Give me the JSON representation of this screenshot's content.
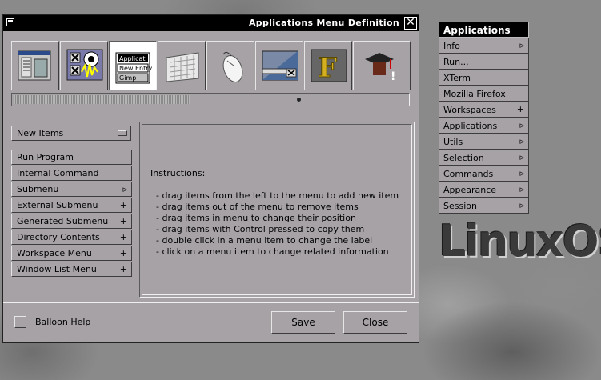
{
  "window": {
    "title": "Applications Menu Definition",
    "close_glyph": "✕"
  },
  "toolbar": {
    "icons": [
      "window-menu-icon",
      "audio-icon",
      "app-entries-icon",
      "keyboard-icon",
      "mouse-icon",
      "window-icon",
      "font-icon",
      "graduation-cap-icon"
    ],
    "active_index": 2,
    "active_texts": [
      "Applicati",
      "New Entry",
      "Gimp"
    ]
  },
  "new_items": {
    "label": "New Items"
  },
  "item_types": [
    {
      "label": "Run Program",
      "marker": ""
    },
    {
      "label": "Internal Command",
      "marker": ""
    },
    {
      "label": "Submenu",
      "marker": "▹"
    },
    {
      "label": "External Submenu",
      "marker": "+"
    },
    {
      "label": "Generated Submenu",
      "marker": "+"
    },
    {
      "label": "Directory Contents",
      "marker": "+"
    },
    {
      "label": "Workspace Menu",
      "marker": "+"
    },
    {
      "label": "Window List Menu",
      "marker": "+"
    }
  ],
  "instructions": {
    "heading": "Instructions:",
    "lines": [
      "- drag items from the left to the menu to add new item",
      "- drag items out of the menu to remove items",
      "- drag items in menu to change their position",
      "- drag items with Control pressed to copy them",
      "- double click in a menu item to change the label",
      "- click on a menu item to change related information"
    ]
  },
  "balloon_help": {
    "label": "Balloon Help",
    "checked": false
  },
  "buttons": {
    "save": "Save",
    "close": "Close"
  },
  "app_menu": {
    "title": "Applications",
    "items": [
      {
        "label": "Info",
        "marker": "▹"
      },
      {
        "label": "Run...",
        "marker": ""
      },
      {
        "label": "XTerm",
        "marker": ""
      },
      {
        "label": "Mozilla Firefox",
        "marker": ""
      },
      {
        "label": "Workspaces",
        "marker": "+"
      },
      {
        "label": "Applications",
        "marker": "▹"
      },
      {
        "label": "Utils",
        "marker": "▹"
      },
      {
        "label": "Selection",
        "marker": "▹"
      },
      {
        "label": "Commands",
        "marker": "▹"
      },
      {
        "label": "Appearance",
        "marker": "▹"
      },
      {
        "label": "Session",
        "marker": "▹"
      }
    ]
  },
  "desktop": {
    "logo_text": "LinuxOS"
  },
  "colors": {
    "panel": "#a6a2a6",
    "title_bg": "#000000",
    "desktop": "#8a8a8a"
  }
}
